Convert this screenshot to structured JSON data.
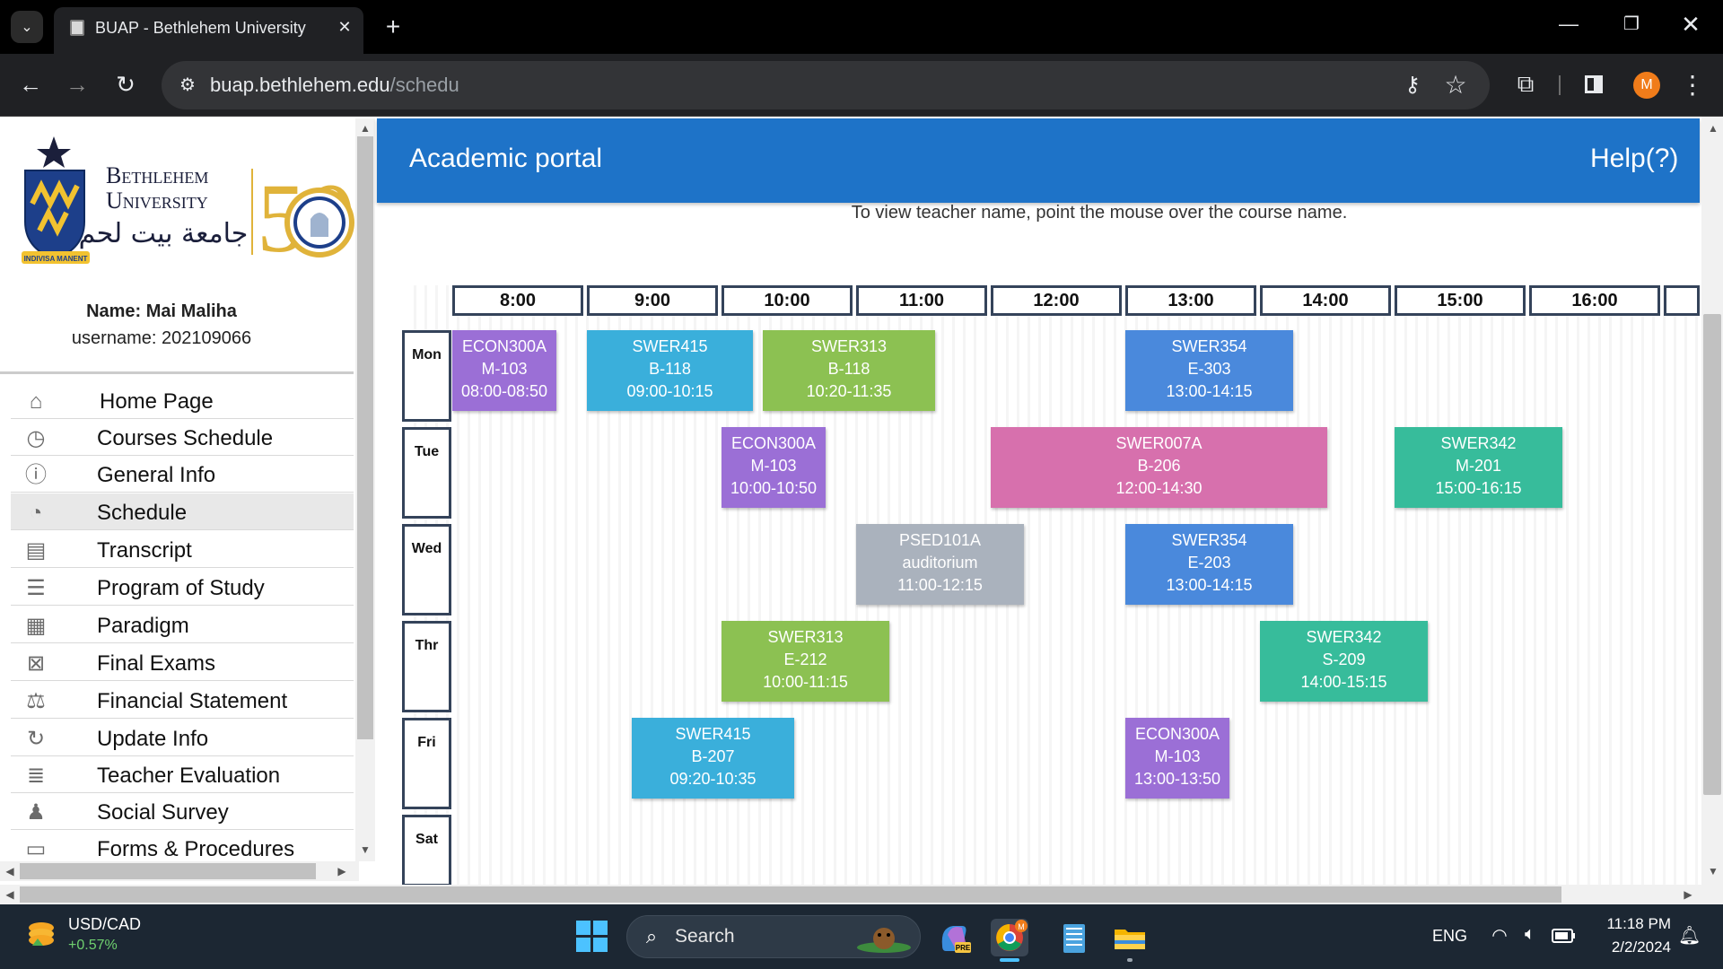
{
  "browser": {
    "tab_title": "BUAP - Bethlehem University",
    "tab_close": "✕",
    "new_tab": "+",
    "url_host": "buap.bethlehem.edu",
    "url_path": "/schedu",
    "icons": [
      "tab-dropdown-icon",
      "back-icon",
      "forward-icon",
      "reload-icon",
      "site-info-icon",
      "password-key-icon",
      "bookmark-star-icon",
      "extensions-icon",
      "side-panel-icon",
      "chrome-menu-icon"
    ],
    "profile_initial": "M",
    "profile_color": "#f07c1a"
  },
  "sidebar": {
    "logo": {
      "line1": "Bethlehem",
      "line2": "University",
      "arabic": "جامعة بيت لحم",
      "motto": "INDIVISA MANENT",
      "anniversary": "50"
    },
    "name_label": "Name: Mai Maliha",
    "username_label": "username: 202109066",
    "items": [
      {
        "label": "Home Page",
        "icon": "home-icon",
        "glyph": "⌂"
      },
      {
        "label": "Courses Schedule",
        "icon": "courses-schedule-icon",
        "glyph": "◷"
      },
      {
        "label": "General Info",
        "icon": "info-icon",
        "glyph": "ⓘ"
      },
      {
        "label": "Schedule",
        "icon": "clock-icon",
        "glyph": "◔"
      },
      {
        "label": "Transcript",
        "icon": "document-icon",
        "glyph": "▤"
      },
      {
        "label": "Program of Study",
        "icon": "list-icon",
        "glyph": "☰"
      },
      {
        "label": "Paradigm",
        "icon": "calendar-icon",
        "glyph": "▦"
      },
      {
        "label": "Final Exams",
        "icon": "calendar-x-icon",
        "glyph": "⊠"
      },
      {
        "label": "Financial Statement",
        "icon": "scale-icon",
        "glyph": "⚖"
      },
      {
        "label": "Update Info",
        "icon": "refresh-icon",
        "glyph": "↻"
      },
      {
        "label": "Teacher Evaluation",
        "icon": "bullet-list-icon",
        "glyph": "≣"
      },
      {
        "label": "Social Survey",
        "icon": "people-icon",
        "glyph": "♟"
      },
      {
        "label": "Forms & Procedures",
        "icon": "forms-icon",
        "glyph": "▭"
      }
    ],
    "active_item": "Schedule"
  },
  "main": {
    "header_title": "Academic portal",
    "help_label": "Help(?)",
    "hint": "To view teacher name, point the mouse over the course name.",
    "times": [
      "8:00",
      "9:00",
      "10:00",
      "11:00",
      "12:00",
      "13:00",
      "14:00",
      "15:00",
      "16:00",
      ""
    ],
    "days": [
      "Mon",
      "Tue",
      "Wed",
      "Thr",
      "Fri",
      "Sat"
    ],
    "courses": [
      {
        "code": "ECON300A",
        "room": "M-103",
        "time": "08:00-08:50",
        "day": "Mon",
        "color": "#9b6fd6"
      },
      {
        "code": "SWER415",
        "room": "B-118",
        "time": "09:00-10:15",
        "day": "Mon",
        "color": "#3aafdb"
      },
      {
        "code": "SWER313",
        "room": "B-118",
        "time": "10:20-11:35",
        "day": "Mon",
        "color": "#8cc152"
      },
      {
        "code": "SWER354",
        "room": "E-303",
        "time": "13:00-14:15",
        "day": "Mon",
        "color": "#4a89dc"
      },
      {
        "code": "ECON300A",
        "room": "M-103",
        "time": "10:00-10:50",
        "day": "Tue",
        "color": "#9b6fd6"
      },
      {
        "code": "SWER007A",
        "room": "B-206",
        "time": "12:00-14:30",
        "day": "Tue",
        "color": "#d770ad"
      },
      {
        "code": "SWER342",
        "room": "M-201",
        "time": "15:00-16:15",
        "day": "Tue",
        "color": "#37bc9b"
      },
      {
        "code": "PSED101A",
        "room": "auditorium",
        "time": "11:00-12:15",
        "day": "Wed",
        "color": "#aab2bd"
      },
      {
        "code": "SWER354",
        "room": "E-203",
        "time": "13:00-14:15",
        "day": "Wed",
        "color": "#4a89dc"
      },
      {
        "code": "SWER313",
        "room": "E-212",
        "time": "10:00-11:15",
        "day": "Thr",
        "color": "#8cc152"
      },
      {
        "code": "SWER342",
        "room": "S-209",
        "time": "14:00-15:15",
        "day": "Thr",
        "color": "#37bc9b"
      },
      {
        "code": "SWER415",
        "room": "B-207",
        "time": "09:20-10:35",
        "day": "Fri",
        "color": "#3aafdb"
      },
      {
        "code": "ECON300A",
        "room": "M-103",
        "time": "13:00-13:50",
        "day": "Fri",
        "color": "#9b6fd6"
      }
    ]
  },
  "taskbar": {
    "widget_title": "USD/CAD",
    "widget_value": "+0.57%",
    "search_label": "Search",
    "language": "ENG",
    "time": "11:18 PM",
    "date": "2/2/2024",
    "apps": [
      "copilot-icon",
      "chrome-icon",
      "notepad-icon",
      "file-explorer-icon"
    ]
  }
}
